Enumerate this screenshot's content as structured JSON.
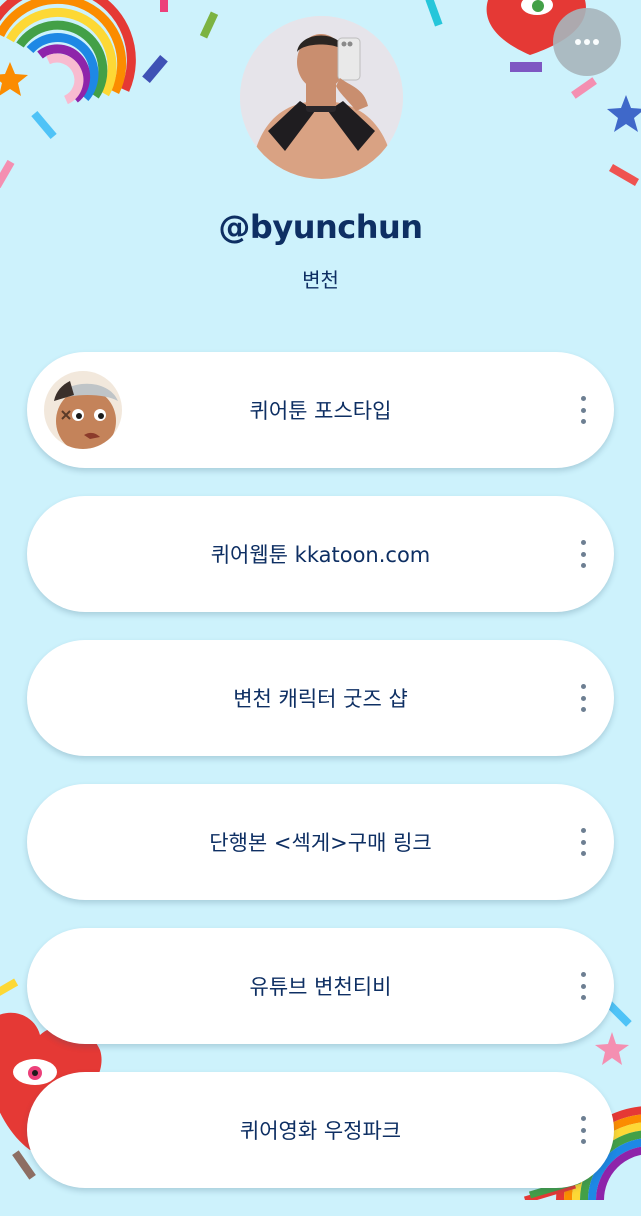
{
  "profile": {
    "username": "@byunchun",
    "display_name": "변천"
  },
  "links": [
    {
      "label": "퀴어툰 포스타입",
      "has_thumbnail": true
    },
    {
      "label": "퀴어웹툰 kkatoon.com",
      "has_thumbnail": false
    },
    {
      "label": "변천 캐릭터 굿즈 샵",
      "has_thumbnail": false
    },
    {
      "label": "단행본 <섹게>구매 링크",
      "has_thumbnail": false
    },
    {
      "label": "유튜브 변천티비",
      "has_thumbnail": false
    },
    {
      "label": "퀴어영화 우정파크",
      "has_thumbnail": false
    }
  ],
  "colors": {
    "background": "#cdf2fc",
    "text": "#0e2f63",
    "card": "#ffffff"
  },
  "icons": {
    "more": "more-horizontal-icon",
    "link_menu": "kebab-vertical-icon"
  }
}
